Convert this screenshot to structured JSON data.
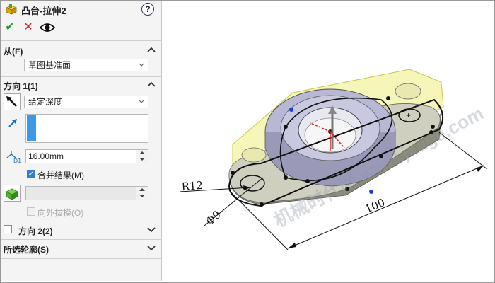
{
  "panel": {
    "title": "凸台-拉伸2",
    "help_label": "?",
    "toolbar": {
      "ok_glyph": "✔",
      "cancel_glyph": "✕",
      "preview_glyph": "👁"
    },
    "from": {
      "header": "从(F)",
      "selected": "草图基准面"
    },
    "direction1": {
      "header": "方向 1(1)",
      "end_condition": "给定深度",
      "depth": "16.00mm",
      "merge_label": "合并结果(M)",
      "merge_checked": true,
      "draft_label": "向外拔模(O)",
      "draft_enabled": false
    },
    "direction2": {
      "header": "方向 2(2)",
      "checked": false
    },
    "contours": {
      "header": "所选轮廓(S)"
    }
  },
  "viewport": {
    "dim_radius": "R12",
    "dim_diameter": "Φ9",
    "dim_length": "100",
    "watermark": "机械时代网 www.jxage.com"
  },
  "colors": {
    "accent": "#3b9ae8",
    "ok_green": "#1f9a2a",
    "cancel_red": "#d42222",
    "preview_yellow": "#f4f4a0"
  }
}
